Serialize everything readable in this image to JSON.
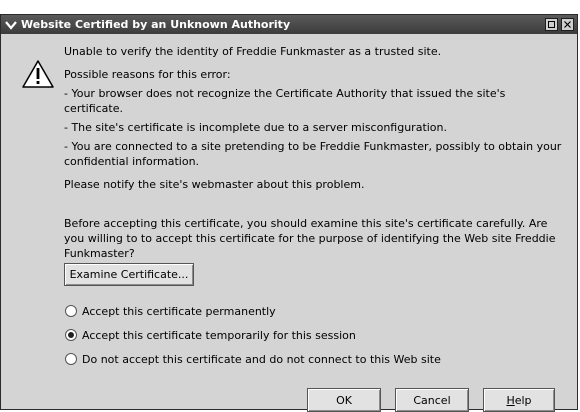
{
  "window": {
    "title": "Website Certified by an Unknown Authority"
  },
  "message": {
    "headline": "Unable to verify the identity of Freddie Funkmaster as a trusted site.",
    "reasons_heading": "Possible reasons for this error:",
    "reasons": [
      "- Your browser does not recognize the Certificate Authority that issued the site's certificate.",
      "- The site's certificate is incomplete due to a server misconfiguration.",
      "- You are connected to a site pretending to be Freddie Funkmaster, possibly to obtain your confidential information."
    ],
    "notify": "Please notify the site's webmaster about this problem.",
    "advice": "Before accepting this certificate, you should examine this site's certificate carefully. Are you willing to to accept this certificate for the purpose of identifying the Web site Freddie Funkmaster?"
  },
  "examine_label": "Examine Certificate...",
  "options": [
    {
      "label": "Accept this certificate permanently",
      "selected": false
    },
    {
      "label": "Accept this certificate temporarily for this session",
      "selected": true
    },
    {
      "label": "Do not accept this certificate and do not connect to this Web site",
      "selected": false
    }
  ],
  "buttons": {
    "ok": "OK",
    "cancel": "Cancel",
    "help_mnemonic": "H",
    "help_rest": "elp"
  }
}
